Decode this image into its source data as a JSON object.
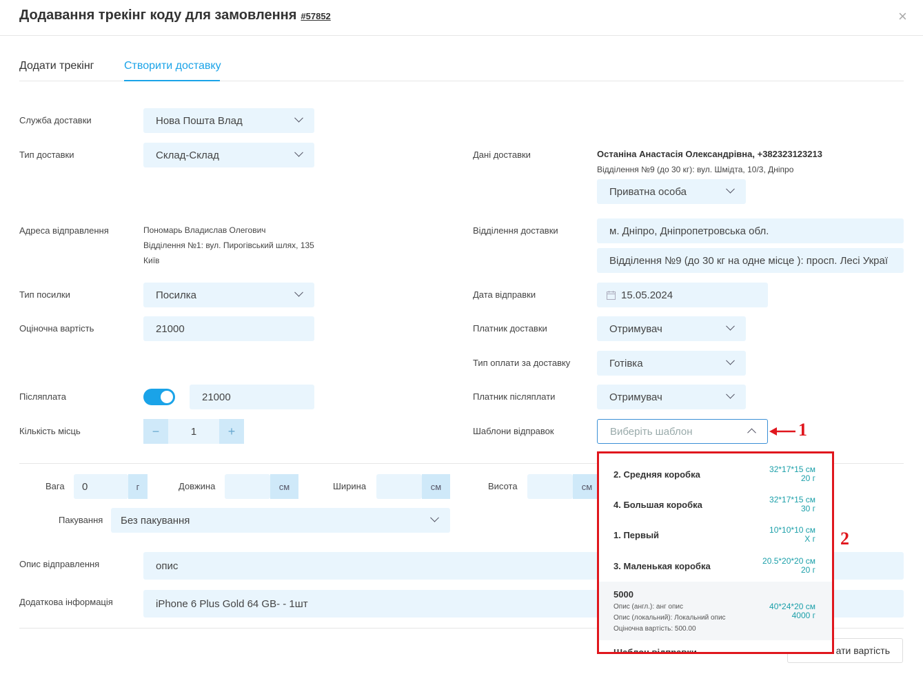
{
  "header": {
    "title": "Додавання трекінг коду для замовлення",
    "order_number": "#57852",
    "close": "×"
  },
  "tabs": [
    {
      "label": "Додати трекінг"
    },
    {
      "label": "Створити доставку"
    }
  ],
  "left": {
    "service_label": "Служба доставки",
    "service_value": "Нова Пошта Влад",
    "delivery_type_label": "Тип доставки",
    "delivery_type_value": "Склад-Склад",
    "sender_address_label": "Адреса відправлення",
    "sender_name": "Пономарь Владислав Олегович",
    "sender_branch": "Відділення №1: вул. Пирогівський шлях, 135",
    "sender_city": "Київ",
    "parcel_type_label": "Тип посилки",
    "parcel_type_value": "Посилка",
    "declared_value_label": "Оціночна вартість",
    "declared_value": "21000",
    "cod_label": "Післяплата",
    "cod_value": "21000",
    "places_label": "Кількість місць",
    "places_value": "1",
    "minus": "−",
    "plus": "+"
  },
  "right": {
    "delivery_data_label": "Дані доставки",
    "recipient": "Останіна Анастасія Олександрівна, +382323123213",
    "recipient_branch": "Відділення №9 (до 30 кг): вул. Шмідта, 10/3, Дніпро",
    "person_type": "Приватна особа",
    "branch_label": "Відділення доставки",
    "city_value": "м. Дніпро, Дніпропетровська обл.",
    "branch_value": "Відділення №9 (до 30 кг на одне місце ): просп. Лесі Украї",
    "ship_date_label": "Дата відправки",
    "ship_date_value": "15.05.2024",
    "payer_label": "Платник доставки",
    "payer_value": "Отримувач",
    "payment_type_label": "Тип оплати за доставку",
    "payment_type_value": "Готівка",
    "cod_payer_label": "Платник післяплати",
    "cod_payer_value": "Отримувач",
    "templates_label": "Шаблони відправок",
    "templates_placeholder": "Виберіть шаблон"
  },
  "dims": {
    "weight_label": "Вага",
    "weight_value": "0",
    "weight_unit": "г",
    "length_label": "Довжина",
    "length_unit": "см",
    "width_label": "Ширина",
    "width_unit": "см",
    "height_label": "Висота",
    "height_unit": "см",
    "packing_label": "Пакування",
    "packing_value": "Без пакування"
  },
  "bottom": {
    "description_label": "Опис відправлення",
    "description_value": "опис",
    "additional_label": "Додаткова інформація",
    "additional_value": "iPhone 6 Plus Gold 64 GB- - 1шт",
    "calc_button": "ати вартість"
  },
  "dropdown": {
    "items": [
      {
        "name": "2. Средняя коробка",
        "dims": "32*17*15 см",
        "weight": "20 г"
      },
      {
        "name": "4. Большая коробка",
        "dims": "32*17*15 см",
        "weight": "30 г"
      },
      {
        "name": "1. Первый",
        "dims": "10*10*10 см",
        "weight": "X г"
      },
      {
        "name": "3. Маленькая коробка",
        "dims": "20.5*20*20 см",
        "weight": "20 г"
      },
      {
        "name": "5000",
        "dims": "40*24*20 см",
        "weight": "4000 г",
        "desc_en": "Опис (англ.): анг опис",
        "desc_local": "Опис (локальний): Локальний опис",
        "value": "Оціночна вартість: 500.00"
      },
      {
        "name": "Шаблон відправки"
      }
    ]
  },
  "annotations": {
    "one": "1",
    "two": "2"
  },
  "colors": {
    "accent": "#1aa3e8",
    "field_bg": "#e9f5fd",
    "annotation": "#e0161d",
    "dims_text": "#1a9fa9"
  }
}
